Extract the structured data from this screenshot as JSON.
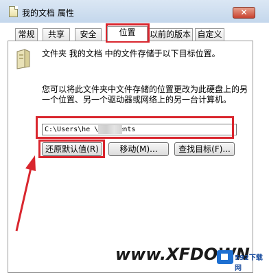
{
  "window": {
    "title": "我的文档 属性",
    "close_glyph": "✕"
  },
  "tabs": [
    {
      "label": "常规",
      "active": false
    },
    {
      "label": "共享",
      "active": false
    },
    {
      "label": "安全",
      "active": false
    },
    {
      "label": "位置",
      "active": true
    },
    {
      "label": "以前的版本",
      "active": false
    },
    {
      "label": "自定义",
      "active": false
    }
  ],
  "location": {
    "description_1": "文件夹 我的文档 中的文件存储于以下目标位置。",
    "description_2": "您可以将此文件夹中文件存储的位置更改为此硬盘上的另一个位置、另一个驱动器或网络上的另一台计算机。",
    "path_value": "C:\\Users\\he        \\Documents",
    "restore_default_label": "还原默认值(R)",
    "move_label": "移动(M)...",
    "find_target_label": "查找目标(F)..."
  },
  "watermark": {
    "text": "www.XFDOWN",
    "site": "592下载网"
  },
  "colors": {
    "highlight": "#d9262e",
    "titlebar": "#c4d7ec"
  }
}
